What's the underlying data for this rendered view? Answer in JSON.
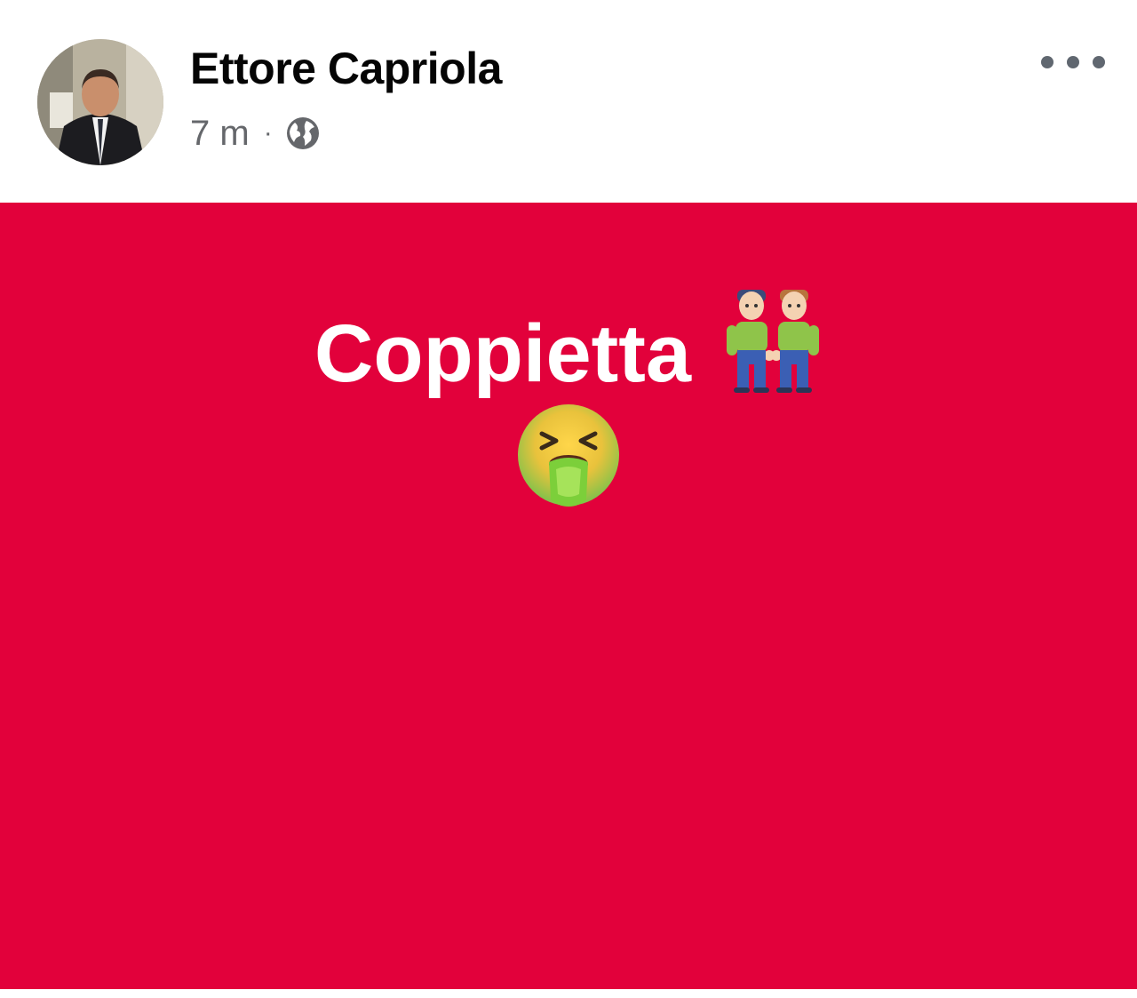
{
  "post": {
    "author": {
      "name": "Ettore Capriola"
    },
    "meta": {
      "time": "7 m",
      "separator": "·",
      "audience_icon": "globe-icon"
    },
    "menu_icon": "more-options-icon",
    "content": {
      "text": "Coppietta",
      "emoji_1": "two-men-holding-hands-emoji",
      "emoji_2": "nauseated-vomiting-face-emoji",
      "background_color": "#e2013b",
      "text_color": "#ffffff"
    }
  }
}
